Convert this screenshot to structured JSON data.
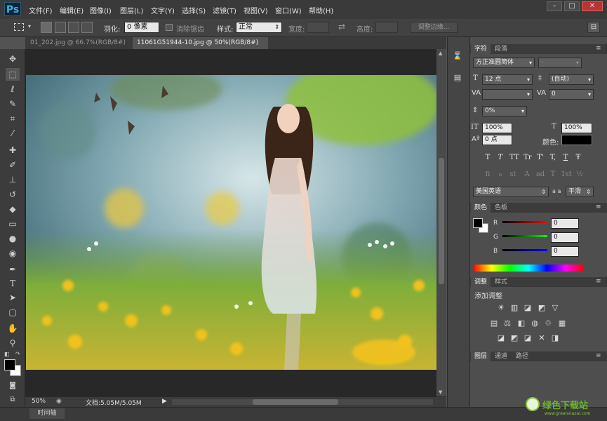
{
  "app": {
    "logo": "Ps"
  },
  "menu": [
    "文件(F)",
    "编辑(E)",
    "图像(I)",
    "图层(L)",
    "文字(Y)",
    "选择(S)",
    "滤镜(T)",
    "视图(V)",
    "窗口(W)",
    "帮助(H)"
  ],
  "window": {
    "minimize": "–",
    "restore": "□",
    "close": "✕"
  },
  "options": {
    "feather_label": "羽化:",
    "feather_value": "0 像素",
    "antialias_label": "消除锯齿",
    "style_label": "样式:",
    "style_value": "正常",
    "width_label": "宽度:",
    "height_label": "高度:",
    "refine_button": "调整边缘..."
  },
  "tabs": [
    {
      "label": "01_202.jpg @ 66.7%(RGB/8#)",
      "close": "×"
    },
    {
      "label": "11061G51944-10.jpg @ 50%(RGB/8#)",
      "close": "×"
    }
  ],
  "status": {
    "zoom": "50%",
    "doc": "文档:5.05M/5.05M",
    "arrow": "▶"
  },
  "timeline": {
    "label": "时间轴"
  },
  "char_panel": {
    "tab_active": "字符",
    "tab_other": "段落",
    "font_family": "方正准圆简体",
    "font_style": "-",
    "size": "12 点",
    "leading": "(自动)",
    "kerning": "",
    "tracking": "0",
    "shift": "0%",
    "vscale": "100%",
    "hscale": "100%",
    "baseline": "0 点",
    "color_label": "颜色:",
    "language": "美国英语",
    "aa": "平滑",
    "aa_icon": "a a"
  },
  "char_buttons": [
    "T",
    "T",
    "TT",
    "Tr",
    "T'",
    "T,",
    "T",
    "Ŧ"
  ],
  "ot_buttons": [
    "fi",
    "ℴ",
    "st",
    "A",
    "ad",
    "T",
    "1st",
    "½"
  ],
  "color_panel": {
    "tab_active": "颜色",
    "tab_other": "色板",
    "r_label": "R",
    "g_label": "G",
    "b_label": "B",
    "r": "0",
    "g": "0",
    "b": "0"
  },
  "adjust_panel": {
    "tab_active": "调整",
    "tab_other": "样式",
    "title": "添加调整"
  },
  "layers_panel": {
    "tab_active": "图层",
    "tab_2": "通道",
    "tab_3": "路径"
  },
  "watermark": {
    "text": "绿色下载站",
    "sub": "www.greenxiazai.com"
  },
  "colors": {
    "menubar": "#3a3a3a",
    "panel": "#4e4e4e",
    "accent": "#3fa9e0"
  }
}
